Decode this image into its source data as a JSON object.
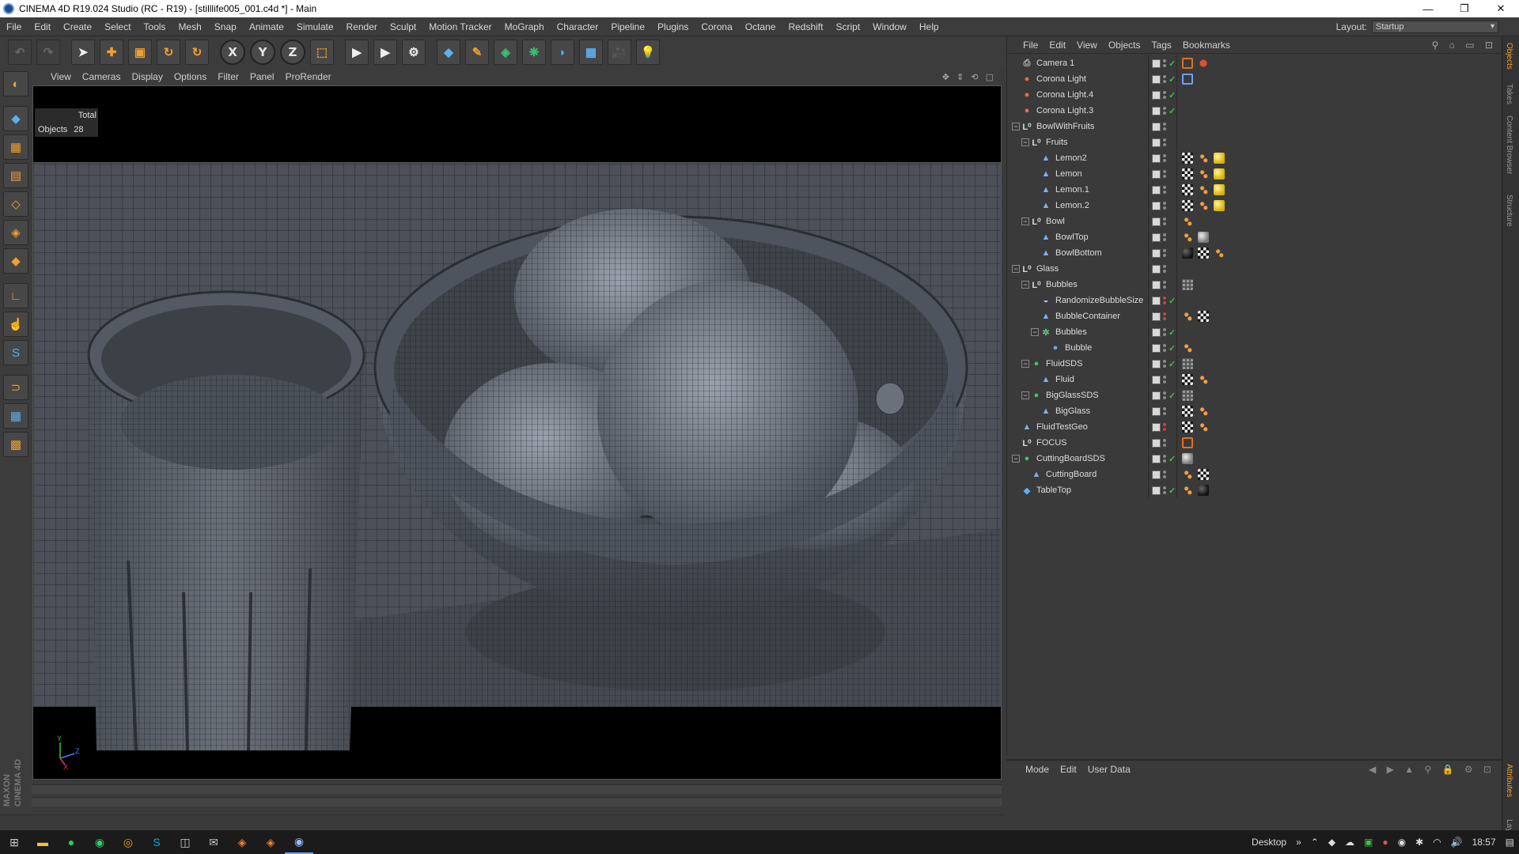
{
  "window": {
    "title": "CINEMA 4D R19.024 Studio (RC - R19) - [stilllife005_001.c4d *] - Main",
    "minimize": "—",
    "maximize": "❐",
    "close": "✕"
  },
  "menubar": {
    "items": [
      "File",
      "Edit",
      "Create",
      "Select",
      "Tools",
      "Mesh",
      "Snap",
      "Animate",
      "Simulate",
      "Render",
      "Sculpt",
      "Motion Tracker",
      "MoGraph",
      "Character",
      "Pipeline",
      "Plugins",
      "Corona",
      "Octane",
      "Redshift",
      "Script",
      "Window",
      "Help"
    ],
    "layout_label": "Layout:",
    "layout_value": "Startup"
  },
  "toolbar": {
    "undo": "↶",
    "redo": "↷",
    "live_select": "➤",
    "move": "✚",
    "scale": "▣",
    "rotate": "↻",
    "rotate2": "↻",
    "x_axis": "X",
    "y_axis": "Y",
    "z_axis": "Z",
    "coord": "⬚",
    "render_view": "▶",
    "render_pv": "▶",
    "render_settings": "⚙",
    "cube": "◆",
    "pen": "✎",
    "subdiv": "◈",
    "mograph": "❋",
    "deformer": "◗",
    "floor": "▦",
    "camera": "🎥",
    "light": "💡"
  },
  "viewport": {
    "menu": [
      "View",
      "Cameras",
      "Display",
      "Options",
      "Filter",
      "Panel",
      "ProRender"
    ],
    "hud_total": "Total",
    "hud_objects_label": "Objects",
    "hud_objects_value": "28",
    "axis_y": "Y",
    "axis_z": "Z",
    "axis_x": "X"
  },
  "object_manager": {
    "menu": [
      "File",
      "Edit",
      "View",
      "Objects",
      "Tags",
      "Bookmarks"
    ],
    "objects": [
      {
        "name": "Camera 1",
        "indent": 0,
        "icon": "camera",
        "expander": "",
        "check": "✓",
        "dot": "gray",
        "tags": [
          "noentry",
          "camtag"
        ]
      },
      {
        "name": "Corona Light",
        "indent": 0,
        "icon": "light",
        "expander": "",
        "check": "✓",
        "dot": "gray",
        "tags": [
          "target"
        ]
      },
      {
        "name": "Corona Light.4",
        "indent": 0,
        "icon": "light",
        "expander": "",
        "check": "✓",
        "dot": "gray",
        "tags": []
      },
      {
        "name": "Corona Light.3",
        "indent": 0,
        "icon": "light",
        "expander": "",
        "check": "✓",
        "dot": "gray",
        "tags": []
      },
      {
        "name": "BowlWithFruits",
        "indent": 0,
        "icon": "null",
        "expander": "−",
        "check": "",
        "dot": "gray",
        "tags": []
      },
      {
        "name": "Fruits",
        "indent": 1,
        "icon": "null",
        "expander": "−",
        "check": "",
        "dot": "gray",
        "tags": []
      },
      {
        "name": "Lemon2",
        "indent": 2,
        "icon": "poly",
        "expander": "",
        "check": "",
        "dot": "gray",
        "tags": [
          "checker",
          "phong",
          "yellow"
        ]
      },
      {
        "name": "Lemon",
        "indent": 2,
        "icon": "poly",
        "expander": "",
        "check": "",
        "dot": "gray",
        "tags": [
          "checker",
          "phong",
          "yellow"
        ]
      },
      {
        "name": "Lemon.1",
        "indent": 2,
        "icon": "poly",
        "expander": "",
        "check": "",
        "dot": "gray",
        "tags": [
          "checker",
          "phong",
          "yellow"
        ]
      },
      {
        "name": "Lemon.2",
        "indent": 2,
        "icon": "poly",
        "expander": "",
        "check": "",
        "dot": "gray",
        "tags": [
          "checker",
          "phong",
          "yellow"
        ]
      },
      {
        "name": "Bowl",
        "indent": 1,
        "icon": "null",
        "expander": "−",
        "check": "",
        "dot": "gray",
        "tags": [
          "phong"
        ]
      },
      {
        "name": "BowlTop",
        "indent": 2,
        "icon": "poly",
        "expander": "",
        "check": "",
        "dot": "gray",
        "tags": [
          "phong",
          "gray"
        ]
      },
      {
        "name": "BowlBottom",
        "indent": 2,
        "icon": "poly",
        "expander": "",
        "check": "",
        "dot": "gray",
        "tags": [
          "dark",
          "checker",
          "phong"
        ]
      },
      {
        "name": "Glass",
        "indent": 0,
        "icon": "null",
        "expander": "−",
        "check": "",
        "dot": "gray",
        "tags": []
      },
      {
        "name": "Bubbles",
        "indent": 1,
        "icon": "null",
        "expander": "−",
        "check": "",
        "dot": "gray",
        "tags": [
          "bubbles"
        ]
      },
      {
        "name": "RandomizeBubbleSize",
        "indent": 2,
        "icon": "effector",
        "expander": "",
        "check": "✓",
        "dot": "red",
        "tags": []
      },
      {
        "name": "BubbleContainer",
        "indent": 2,
        "icon": "poly",
        "expander": "",
        "check": "",
        "dot": "red",
        "tags": [
          "phong",
          "checker"
        ]
      },
      {
        "name": "Bubbles",
        "indent": 2,
        "icon": "cloner",
        "expander": "−",
        "check": "✓",
        "dot": "gray",
        "tags": []
      },
      {
        "name": "Bubble",
        "indent": 3,
        "icon": "sphere",
        "expander": "",
        "check": "✓",
        "dot": "gray",
        "tags": [
          "phong"
        ]
      },
      {
        "name": "FluidSDS",
        "indent": 1,
        "icon": "sds",
        "expander": "−",
        "check": "✓",
        "dot": "gray",
        "tags": [
          "bubbles"
        ]
      },
      {
        "name": "Fluid",
        "indent": 2,
        "icon": "poly",
        "expander": "",
        "check": "",
        "dot": "gray",
        "tags": [
          "checker",
          "phong"
        ]
      },
      {
        "name": "BigGlassSDS",
        "indent": 1,
        "icon": "sds",
        "expander": "−",
        "check": "✓",
        "dot": "gray",
        "tags": [
          "bubbles"
        ]
      },
      {
        "name": "BigGlass",
        "indent": 2,
        "icon": "poly",
        "expander": "",
        "check": "",
        "dot": "gray",
        "tags": [
          "checker",
          "phong"
        ]
      },
      {
        "name": "FluidTestGeo",
        "indent": 0,
        "icon": "poly",
        "expander": "",
        "check": "",
        "dot": "red",
        "tags": [
          "checker",
          "phong"
        ]
      },
      {
        "name": "FOCUS",
        "indent": 0,
        "icon": "null",
        "expander": "",
        "check": "",
        "dot": "gray",
        "tags": [
          "noentry"
        ]
      },
      {
        "name": "CuttingBoardSDS",
        "indent": 0,
        "icon": "sds",
        "expander": "−",
        "check": "✓",
        "dot": "gray",
        "tags": [
          "gray"
        ]
      },
      {
        "name": "CuttingBoard",
        "indent": 1,
        "icon": "poly",
        "expander": "",
        "check": "",
        "dot": "gray",
        "tags": [
          "phong",
          "checker"
        ]
      },
      {
        "name": "TableTop",
        "indent": 0,
        "icon": "cube",
        "expander": "",
        "check": "✓",
        "dot": "gray",
        "tags": [
          "phong",
          "dark"
        ]
      }
    ]
  },
  "attribute_manager": {
    "menu": [
      "Mode",
      "Edit",
      "User Data"
    ]
  },
  "side_tabs": [
    "Objects",
    "Takes",
    "Content Browser",
    "Structure",
    "Attributes",
    "Layers"
  ],
  "logo": "MAXON CINEMA 4D",
  "taskbar": {
    "desktop_label": "Desktop",
    "time": "18:57",
    "chevron": "»"
  },
  "colors": {
    "accent_orange": "#f0a030",
    "accent_blue": "#5ab0f0",
    "check_green": "#40c040"
  }
}
